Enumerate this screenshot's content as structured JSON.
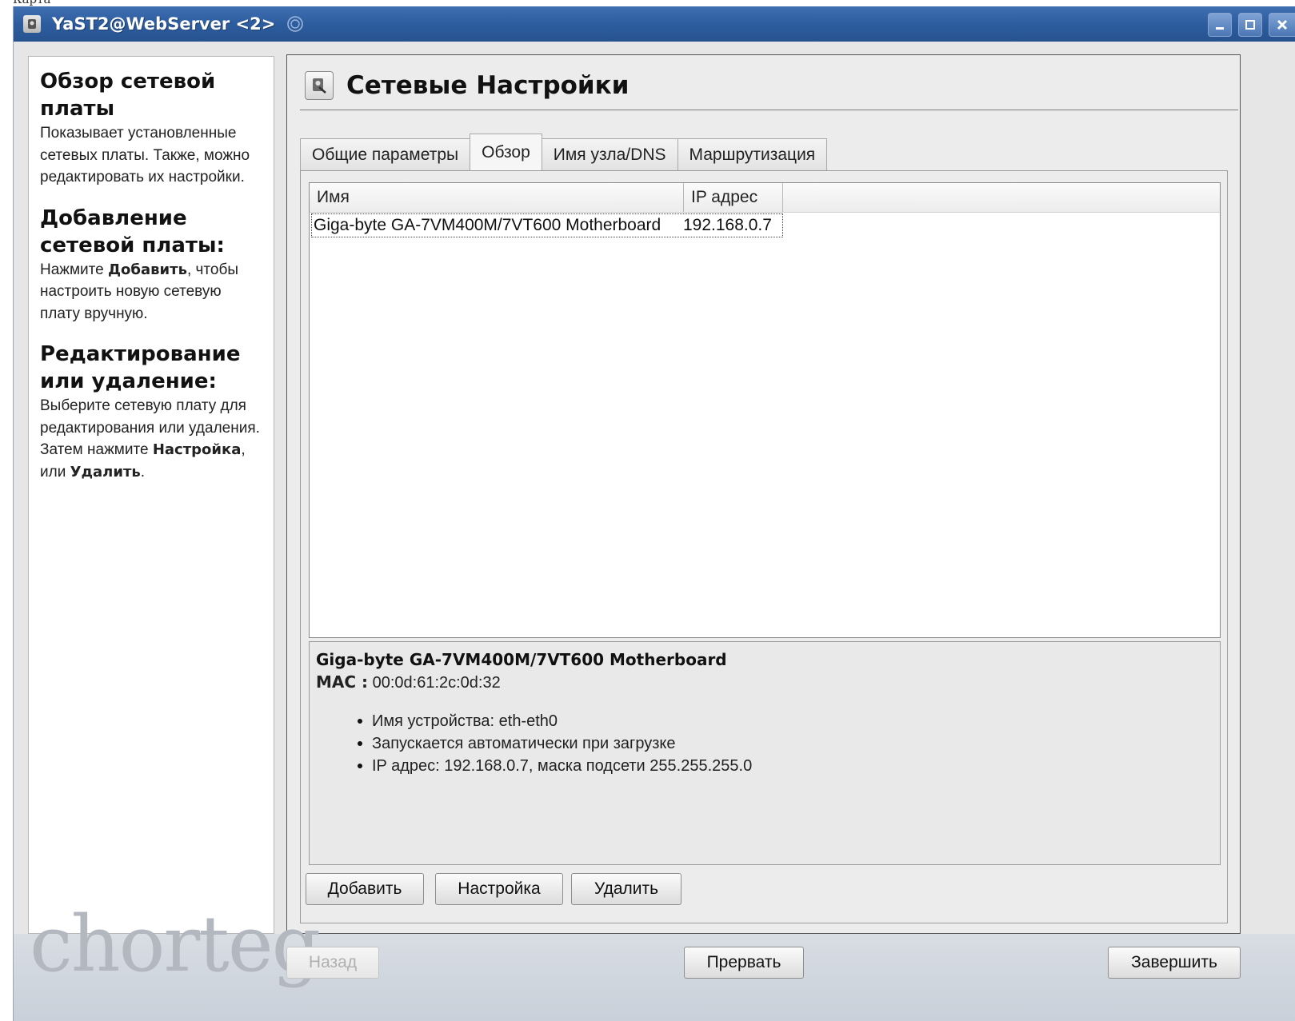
{
  "top_stub": "Карта",
  "window": {
    "title": "YaST2@WebServer <2>",
    "icon": "yast-icon",
    "controls": [
      "minimize-icon",
      "maximize-icon",
      "close-icon"
    ]
  },
  "help": {
    "sections": [
      {
        "heading": "Обзор сетевой платы",
        "text": "Показывает установленные сетевых платы. Также, можно редактировать их настройки."
      },
      {
        "heading": "Добавление сетевой платы:",
        "text_before": "Нажмите ",
        "bold1": "Добавить",
        "text_after": ", чтобы настроить новую сетевую плату вручную."
      },
      {
        "heading": "Редактирование или удаление:",
        "text_before": "Выберите сетевую плату для редактирования или удаления. Затем нажмите ",
        "bold1": "Настройка",
        "middle": ", или ",
        "bold2": "Удалить",
        "text_after": "."
      }
    ]
  },
  "page": {
    "title": "Сетевые Настройки",
    "icon": "network-settings-icon"
  },
  "tabs": [
    {
      "label": "Общие параметры",
      "active": false
    },
    {
      "label": "Обзор",
      "active": true
    },
    {
      "label": "Имя узла/DNS",
      "active": false
    },
    {
      "label": "Маршрутизация",
      "active": false
    }
  ],
  "table": {
    "columns": [
      "Имя",
      "IP адрес"
    ],
    "rows": [
      {
        "name": "Giga-byte GA-7VM400M/7VT600 Motherboard",
        "ip": "192.168.0.7"
      }
    ]
  },
  "details": {
    "title": "Giga-byte GA-7VM400M/7VT600 Motherboard",
    "mac_label": "MAC :",
    "mac_value": " 00:0d:61:2c:0d:32",
    "items": [
      "Имя устройства: eth-eth0",
      "Запускается автоматически при загрузке",
      "IP адрес: 192.168.0.7, маска подсети 255.255.255.0"
    ]
  },
  "actions": {
    "add": "Добавить",
    "configure": "Настройка",
    "delete": "Удалить"
  },
  "footer": {
    "back": "Назад",
    "abort": "Прервать",
    "finish": "Завершить",
    "logo_text": "chorteg"
  }
}
